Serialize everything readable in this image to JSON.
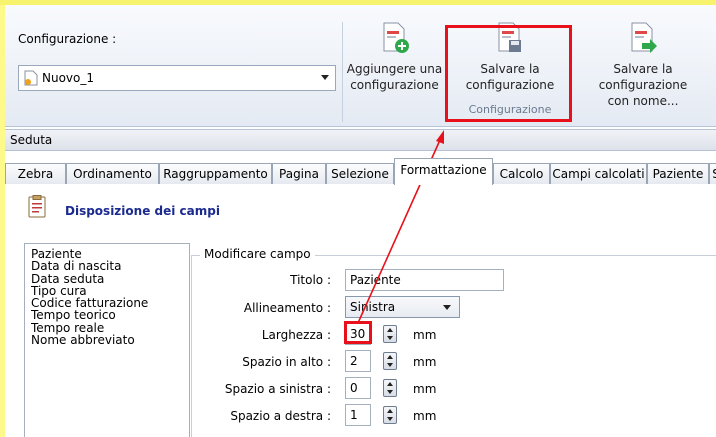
{
  "ribbon": {
    "config_label": "Configurazione :",
    "config_value": "Nuovo_1",
    "btn_add": [
      "Aggiungere una",
      "configurazione"
    ],
    "btn_save": [
      "Salvare la",
      "configurazione"
    ],
    "btn_saveas": [
      "Salvare la configurazione",
      "con nome..."
    ],
    "group_caption": "Configurazione"
  },
  "section": {
    "title": "Seduta"
  },
  "tabs": [
    {
      "label": "Zebra",
      "active": false
    },
    {
      "label": "Ordinamento",
      "active": false
    },
    {
      "label": "Raggruppamento",
      "active": false
    },
    {
      "label": "Pagina",
      "active": false
    },
    {
      "label": "Selezione",
      "active": false
    },
    {
      "label": "Formattazione",
      "active": true
    },
    {
      "label": "Calcolo",
      "active": false
    },
    {
      "label": "Campi calcolati",
      "active": false
    },
    {
      "label": "Paziente",
      "active": false
    },
    {
      "label": "S",
      "active": false
    }
  ],
  "panel": {
    "title": "Disposizione dei campi",
    "fields": [
      "Paziente",
      "Data di nascita",
      "Data seduta",
      "Tipo cura",
      "Codice fatturazione",
      "Tempo teorico",
      "Tempo reale",
      "Nome abbreviato"
    ],
    "group_title": "Modificare campo",
    "titolo_label": "Titolo :",
    "titolo_value": "Paziente",
    "allineamento_label": "Allineamento :",
    "allineamento_value": "Sinistra",
    "larghezza_label": "Larghezza :",
    "larghezza_value": "30",
    "spazio_alto_label": "Spazio in alto :",
    "spazio_alto_value": "2",
    "spazio_sinistra_label": "Spazio a sinistra :",
    "spazio_sinistra_value": "0",
    "spazio_destra_label": "Spazio a destra :",
    "spazio_destra_value": "1",
    "unit": "mm"
  },
  "colors": {
    "highlight": "#e8111b",
    "title_blue": "#1b2a8e",
    "background_yellow": "#fdf98a"
  }
}
